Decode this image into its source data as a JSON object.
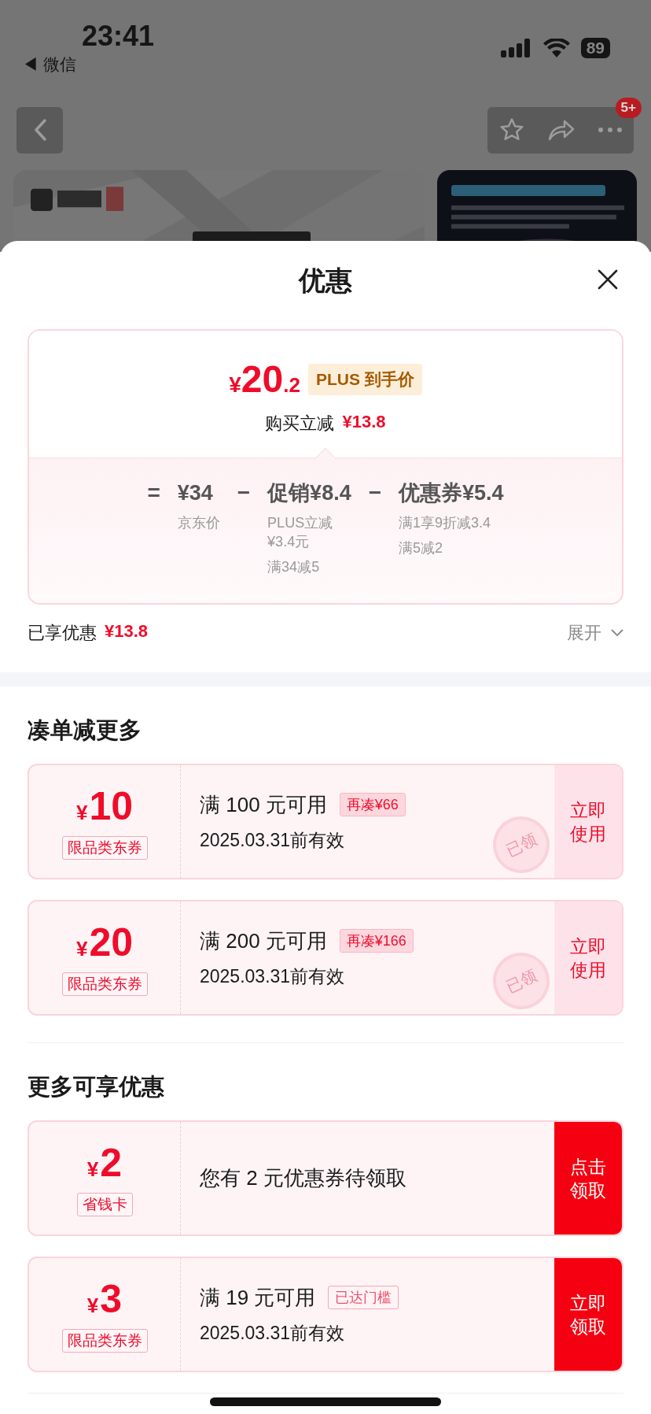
{
  "status_bar": {
    "time": "23:41",
    "back_app": "◀ 微信",
    "battery": "89"
  },
  "nav": {
    "badge": "5+"
  },
  "sheet": {
    "title": "优惠"
  },
  "price_card": {
    "currency": "¥",
    "integer": "20",
    "decimal": ".2",
    "tag": "PLUS 到手价",
    "saving_label": "购买立减",
    "saving_amount": "¥13.8",
    "breakdown": [
      {
        "operator": "=",
        "amount": "¥34",
        "notes": [
          "京东价"
        ]
      },
      {
        "operator": "−",
        "amount": "促销¥8.4",
        "notes": [
          "PLUS立减¥3.4元",
          "满34减5"
        ]
      },
      {
        "operator": "−",
        "amount": "优惠券¥5.4",
        "notes": [
          "满1享9折减3.4",
          "满5减2"
        ]
      }
    ]
  },
  "summary": {
    "label": "已享优惠",
    "amount": "¥13.8",
    "toggle": "展开",
    "expanded": false
  },
  "sections": [
    {
      "title": "凑单减更多",
      "coupons": [
        {
          "currency": "¥",
          "amount": "10",
          "type": "限品类东券",
          "condition": "满 100 元可用",
          "tag": {
            "text": "再凑¥66",
            "kind": "filled"
          },
          "validity": "2025.03.31前有效",
          "stamp": "已领",
          "action": {
            "label": "立即使用",
            "kind": "light"
          }
        },
        {
          "currency": "¥",
          "amount": "20",
          "type": "限品类东券",
          "condition": "满 200 元可用",
          "tag": {
            "text": "再凑¥166",
            "kind": "filled"
          },
          "validity": "2025.03.31前有效",
          "stamp": "已领",
          "action": {
            "label": "立即使用",
            "kind": "light"
          }
        }
      ]
    },
    {
      "title": "更多可享优惠",
      "coupons": [
        {
          "currency": "¥",
          "amount": "2",
          "type": "省钱卡",
          "condition": "您有 2 元优惠券待领取",
          "action": {
            "label": "点击领取",
            "kind": "solid"
          }
        },
        {
          "currency": "¥",
          "amount": "3",
          "type": "限品类东券",
          "condition": "满 19 元可用",
          "tag": {
            "text": "已达门槛",
            "kind": "outline"
          },
          "validity": "2025.03.31前有效",
          "action": {
            "label": "立即领取",
            "kind": "solid"
          }
        }
      ]
    }
  ]
}
